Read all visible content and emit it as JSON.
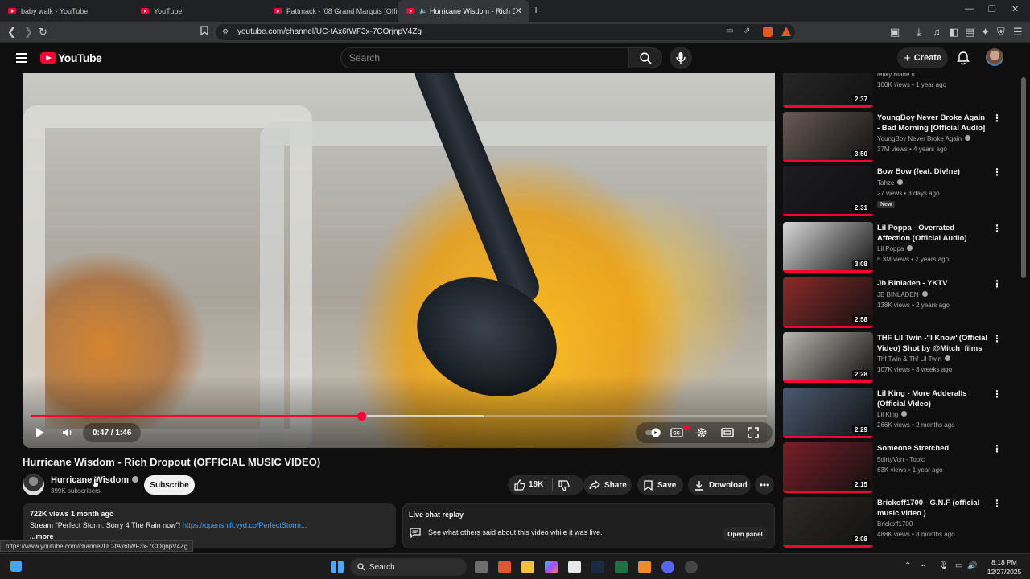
{
  "browser": {
    "tabs": [
      {
        "label": "baby walk - YouTube",
        "active": false
      },
      {
        "label": "YouTube",
        "active": false
      },
      {
        "label": "Fattmack - '08 Grand Marquis [Offici",
        "active": false
      },
      {
        "label": "Hurricane Wisdom - Rich Dro",
        "active": true
      }
    ],
    "url": "youtube.com/channel/UC-tAx6tWF3x-7COrjnpV4Zg",
    "status_url": "https://www.youtube.com/channel/UC-tAx6tWF3x-7COrjnpV4Zg"
  },
  "youtube": {
    "logo_text": "YouTube",
    "search_placeholder": "Search",
    "create_label": "Create"
  },
  "player": {
    "current_time": "0:47",
    "duration": "1:46",
    "time_display": "0:47 / 1:46",
    "progress_fraction": 0.449,
    "buffered_fraction": 0.615,
    "accent_color": "#ff0033"
  },
  "video": {
    "title": "Hurricane Wisdom - Rich Dropout (OFFICIAL MUSIC VIDEO)",
    "channel_name": "Hurricane Wisdom",
    "subscribers": "399K subscribers",
    "subscribe_label": "Subscribe",
    "likes": "18K",
    "share_label": "Share",
    "save_label": "Save",
    "download_label": "Download",
    "more_icon": "more-horizontal-icon"
  },
  "description": {
    "views_date": "722K views  1 month ago",
    "text": "Stream \"Perfect Storm: Sorry 4 The Rain now\"!",
    "link": "https://openshift.vyd.co/PerfectStorm...",
    "more_label": "...more"
  },
  "live_chat": {
    "header": "Live chat replay",
    "text": "See what others said about this video while it was live.",
    "open_label": "Open panel"
  },
  "recommendations": [
    {
      "title": "(Official Music Video)",
      "channel": "Milky Made It",
      "verified": false,
      "meta": "100K views • 1 year ago",
      "duration": "2:37",
      "badge": "",
      "thumb_color": "#2a2a2a"
    },
    {
      "title": "YoungBoy Never Broke Again - Bad Morning [Official Audio]",
      "channel": "YoungBoy Never Broke Again",
      "verified": true,
      "meta": "37M views • 4 years ago",
      "duration": "3:50",
      "badge": "",
      "thumb_color": "#6a5a55"
    },
    {
      "title": "Bow Bow (feat. Div!ne)",
      "channel": "Tahze",
      "verified": true,
      "meta": "27 views • 3 days ago",
      "duration": "2:31",
      "badge": "New",
      "thumb_color": "#1c1c22"
    },
    {
      "title": "Lil Poppa - Overrated Affection (Official Audio)",
      "channel": "Lil Poppa",
      "verified": true,
      "meta": "5.3M views • 2 years ago",
      "duration": "3:08",
      "badge": "",
      "thumb_color": "#d8d8d8"
    },
    {
      "title": "Jb Binladen - YKTV",
      "channel": "JB BINLADEN",
      "verified": true,
      "meta": "138K views • 2 years ago",
      "duration": "2:58",
      "badge": "",
      "thumb_color": "#8b2a2a"
    },
    {
      "title": "THF Lil Twin -\"I Know\"(Official Video) Shot by @Mitch_films",
      "channel": "Thf Twin & Thf Lil Twin",
      "verified": true,
      "meta": "107K views • 3 weeks ago",
      "duration": "2:28",
      "badge": "",
      "thumb_color": "#b9b4ae"
    },
    {
      "title": "Lil King - More Adderalls (Official Video)",
      "channel": "Lil King",
      "verified": true,
      "meta": "266K views • 2 months ago",
      "duration": "2:29",
      "badge": "",
      "thumb_color": "#4a5a70"
    },
    {
      "title": "Someone Stretched",
      "channel": "5dirtyVon - Topic",
      "verified": false,
      "meta": "63K views • 1 year ago",
      "duration": "2:15",
      "badge": "",
      "thumb_color": "#7a1e28"
    },
    {
      "title": "Brickoff1700 - G.N.F (official music video )",
      "channel": "Brickoff1700",
      "verified": false,
      "meta": "488K views • 8 months ago",
      "duration": "2:08",
      "badge": "",
      "thumb_color": "#2e2a28"
    }
  ],
  "taskbar": {
    "search_label": "Search",
    "time": "8:18 PM",
    "date": "12/27/2025"
  }
}
